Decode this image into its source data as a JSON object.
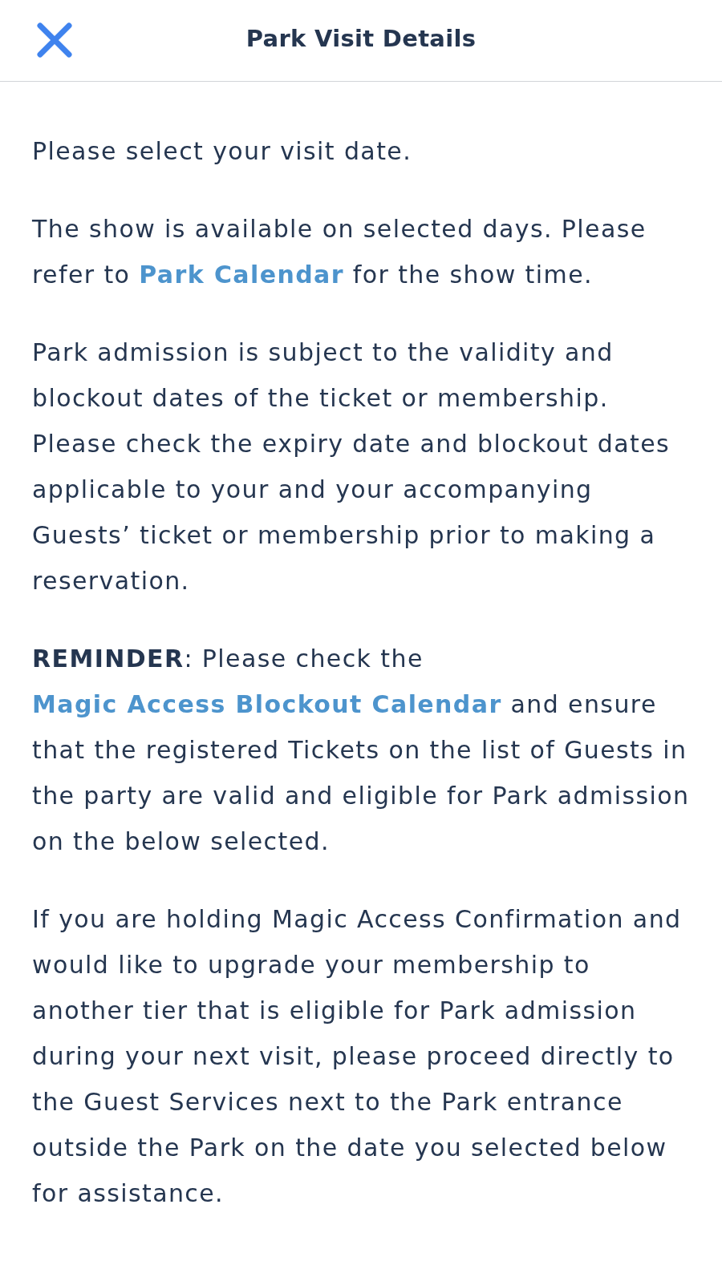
{
  "header": {
    "title": "Park Visit Details"
  },
  "paragraphs": [
    [
      {
        "kind": "text",
        "text": "Please select your visit date."
      }
    ],
    [
      {
        "kind": "text",
        "text": "The show is available on selected days. Please refer to "
      },
      {
        "kind": "link",
        "text": "Park Calendar"
      },
      {
        "kind": "text",
        "text": " for the show time."
      }
    ],
    [
      {
        "kind": "text",
        "text": "Park admission is subject to the validity and blockout dates of the ticket or membership. Please check the expiry date and blockout dates applicable to your and your accompanying Guests’ ticket or membership prior to making a reservation."
      }
    ],
    [
      {
        "kind": "text",
        "text": "**REMINDER**: Please check the "
      },
      {
        "kind": "link",
        "text": "Magic Access Blockout Calendar"
      },
      {
        "kind": "text",
        "text": " and ensure that the registered Tickets on the list of Guests in the party are valid and eligible for Park admission on the below selected."
      }
    ],
    [
      {
        "kind": "text",
        "text": "If you are holding Magic Access Confirmation and would like to upgrade your membership to another tier that is eligible for Park admission during your next visit, please proceed directly to the Guest Services next to the Park entrance outside the Park on the date you selected below for assistance."
      }
    ]
  ]
}
